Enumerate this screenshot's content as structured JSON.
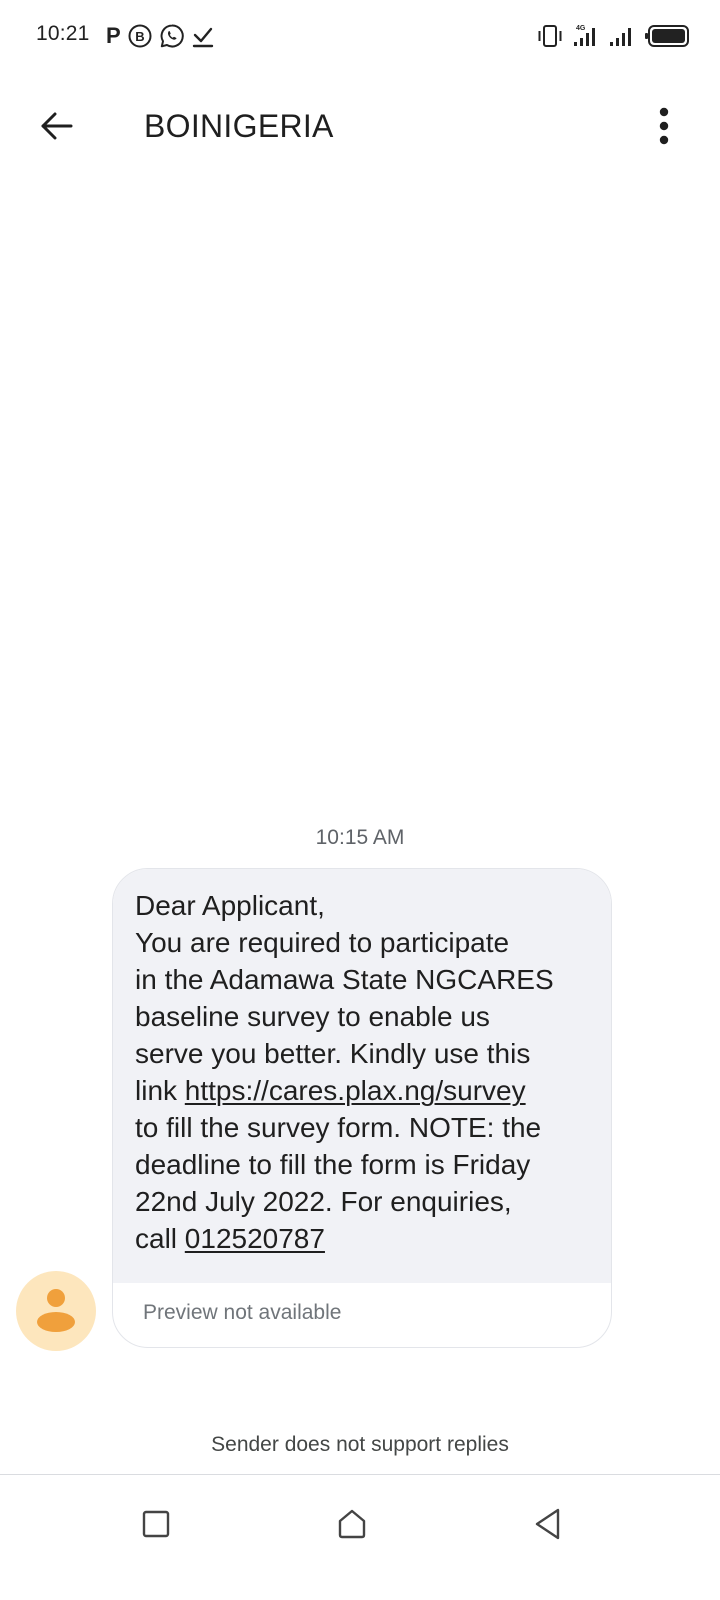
{
  "status_bar": {
    "time": "10:21",
    "left_icons": [
      "parking-p-icon",
      "b-circle-icon",
      "whatsapp-icon",
      "check-download-icon"
    ],
    "p_label": "P",
    "right_icons": [
      "vibrate-icon",
      "signal-sim1-icon",
      "signal-sim2-icon",
      "battery-icon"
    ]
  },
  "app_bar": {
    "title": "BOINIGERIA",
    "back_icon": "arrow-back-icon",
    "menu_icon": "more-vert-icon"
  },
  "conversation": {
    "timestamp": "10:15 AM",
    "message": {
      "line1": "Dear Applicant,",
      "line2": "You are required to participate",
      "line3": "in the Adamawa State NGCARES",
      "line4": "baseline survey to enable us",
      "line5": "serve you better. Kindly use this",
      "line6_prefix": "link ",
      "link_url": "https://cares.plax.ng/survey",
      "line7": "to fill the survey form. NOTE: the",
      "line8": "deadline to fill the form is Friday",
      "line9": "22nd July 2022.  For enquiries,",
      "line10_prefix": "call ",
      "phone": "012520787"
    },
    "preview_text": "Preview not available",
    "avatar_icon": "person-icon",
    "avatar_color": "#fde6bd",
    "avatar_fg": "#f0a03c"
  },
  "footer": {
    "reply_note": "Sender does not support replies"
  },
  "nav_bar": {
    "recents_icon": "square-recents-icon",
    "home_icon": "home-pentagon-icon",
    "back_icon": "triangle-back-icon"
  },
  "colors": {
    "bubble_bg": "#f1f2f6",
    "bubble_border": "#e3e5ea",
    "text": "#1f1f1f",
    "muted": "#5f6368"
  }
}
